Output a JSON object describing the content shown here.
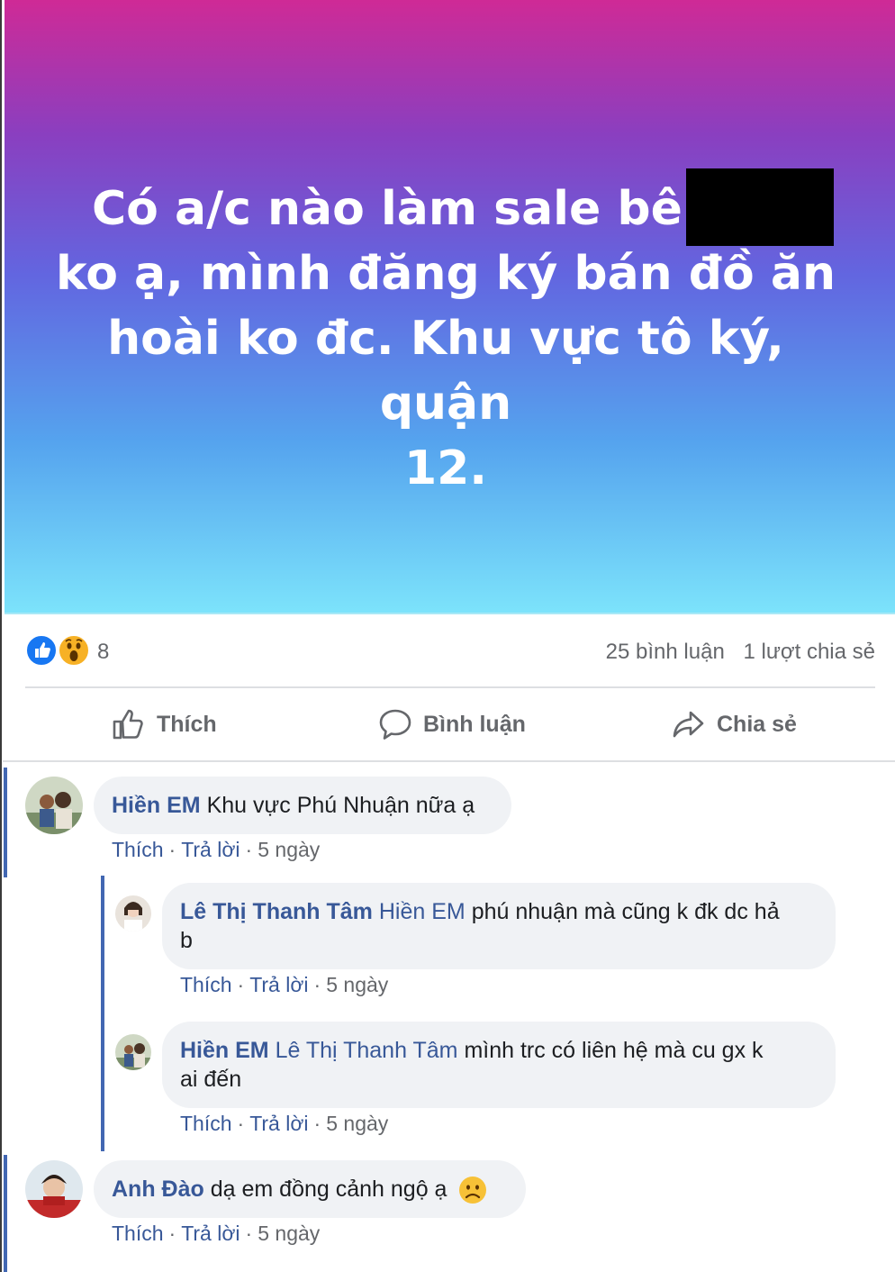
{
  "post": {
    "text_line1": "Có a/c nào làm sale bên",
    "text_line2": "ko ạ, mình đăng ký bán đồ ăn",
    "text_line3": "hoài ko đc. Khu vực tô ký, quận",
    "text_line4": "12."
  },
  "stats": {
    "reaction_count": "8",
    "comments": "25 bình luận",
    "shares": "1 lượt chia sẻ"
  },
  "actions": {
    "like": "Thích",
    "comment": "Bình luận",
    "share": "Chia sẻ"
  },
  "comments": [
    {
      "author": "Hiền EM",
      "text": "Khu vực Phú Nhuận nữa ạ",
      "like": "Thích",
      "reply": "Trả lời",
      "time": "5 ngày",
      "replies": [
        {
          "author": "Lê Thị Thanh Tâm",
          "mention": "Hiền EM",
          "text": "phú nhuận mà cũng k đk dc hả",
          "text_cont": "b",
          "like": "Thích",
          "reply": "Trả lời",
          "time": "5 ngày"
        },
        {
          "author": "Hiền EM",
          "mention": "Lê Thị Thanh Tâm",
          "text": "mình trc có liên hệ mà cu gx k",
          "text_cont": "ai đến",
          "like": "Thích",
          "reply": "Trả lời",
          "time": "5 ngày"
        }
      ]
    },
    {
      "author": "Anh Đào",
      "text": "dạ em đồng cảnh ngộ ạ",
      "like": "Thích",
      "reply": "Trả lời",
      "time": "5 ngày"
    }
  ],
  "icons": [
    "like-reaction-icon",
    "wow-reaction-icon",
    "thumbs-up-icon",
    "comment-icon",
    "share-icon",
    "sad-emoji-icon"
  ],
  "colors": {
    "link": "#385898",
    "like_blue": "#1877f2",
    "thread_bar": "#4267b2",
    "bubble": "#f0f2f5"
  }
}
